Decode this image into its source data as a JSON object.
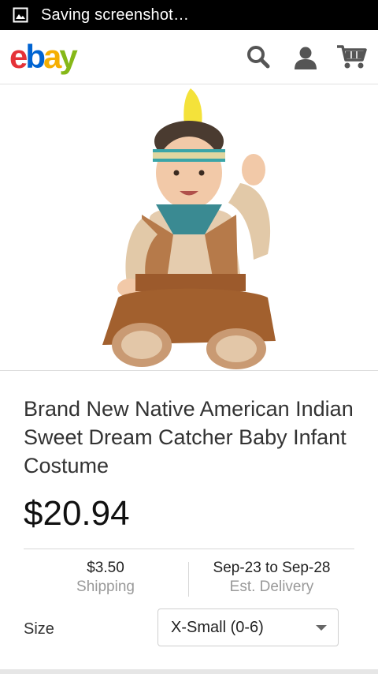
{
  "status_bar": {
    "icon": "image-icon",
    "text": "Saving screenshot…"
  },
  "header": {
    "logo_letters": [
      "e",
      "b",
      "a",
      "y"
    ],
    "logo_colors": [
      "#e53238",
      "#0064d2",
      "#f5af02",
      "#86b817"
    ],
    "icons": [
      "search-icon",
      "user-icon",
      "cart-icon"
    ],
    "icon_color": "#555555"
  },
  "product": {
    "image": "baby-costume-photo",
    "title": "Brand New Native American Indian Sweet Dream Catcher Baby Infant Costume",
    "price": "$20.94",
    "shipping": {
      "value": "$3.50",
      "label": "Shipping"
    },
    "delivery": {
      "value": "Sep-23 to Sep-28",
      "label": "Est. Delivery"
    },
    "size": {
      "label": "Size",
      "selected": "X-Small (0-6)"
    }
  }
}
